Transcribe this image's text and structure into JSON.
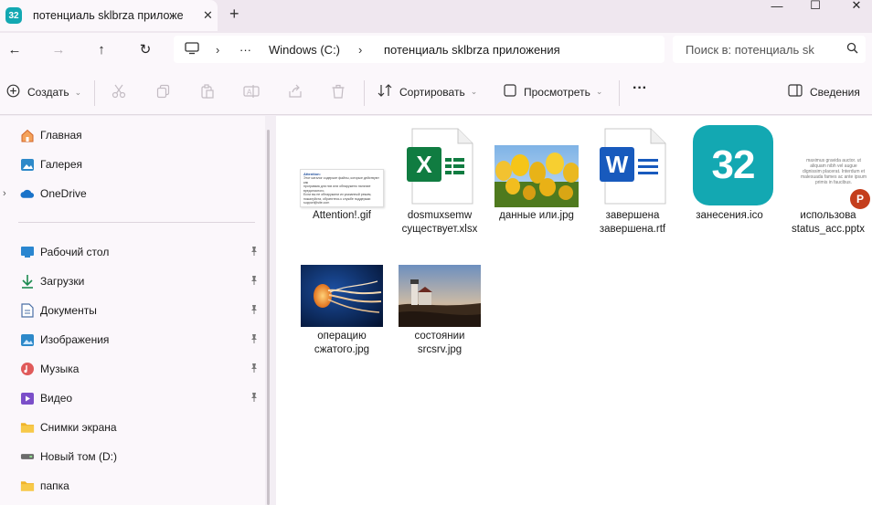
{
  "window": {
    "tab_title": "потенциаль sklbrza приложе",
    "app_badge": "32",
    "close_glyph": "✕",
    "new_tab_glyph": "+",
    "minimize_glyph": "—",
    "maximize_glyph": "☐",
    "window_close_glyph": "✕"
  },
  "nav": {
    "back_glyph": "←",
    "forward_glyph": "→",
    "up_glyph": "↑",
    "refresh_glyph": "↻",
    "more_glyph": "···",
    "separator_glyph": "›",
    "breadcrumb": [
      "Windows (C:)",
      "потенциаль sklbrza приложения"
    ],
    "search_placeholder": "Поиск в:  потенциаль sk",
    "search_icon": "⌕"
  },
  "toolbar": {
    "create_label": "Создать",
    "sort_label": "Сортировать",
    "view_label": "Просмотреть",
    "more_label": "···",
    "details_label": "Сведения",
    "icons": [
      "cut-icon",
      "copy-icon",
      "paste-icon",
      "rename-icon",
      "share-icon",
      "delete-icon"
    ]
  },
  "sidebar": {
    "top_items": [
      {
        "label": "Главная",
        "icon": "home-icon",
        "glyph": "⌂",
        "color": "#e36f2c"
      },
      {
        "label": "Галерея",
        "icon": "gallery-icon",
        "glyph": "▣",
        "color": "#1e7bc4"
      },
      {
        "label": "OneDrive",
        "icon": "onedrive-icon",
        "glyph": "☁",
        "color": "#1a73c9"
      }
    ],
    "pinned_items": [
      {
        "label": "Рабочий стол",
        "icon": "desktop-icon",
        "glyph": "▬",
        "color": "#2a86d0"
      },
      {
        "label": "Загрузки",
        "icon": "downloads-icon",
        "glyph": "↓",
        "color": "#1b8a4f"
      },
      {
        "label": "Документы",
        "icon": "documents-icon",
        "glyph": "▤",
        "color": "#4b6fa5"
      },
      {
        "label": "Изображения",
        "icon": "pictures-icon",
        "glyph": "▲",
        "color": "#2d89c9"
      },
      {
        "label": "Музыка",
        "icon": "music-icon",
        "glyph": "♪",
        "color": "#d9534f"
      },
      {
        "label": "Видео",
        "icon": "video-icon",
        "glyph": "▶",
        "color": "#7b4fc9"
      }
    ],
    "other_items": [
      {
        "label": "Снимки экрана",
        "icon": "folder-icon",
        "glyph": "▬",
        "color": "#f0b429"
      },
      {
        "label": "Новый том (D:)",
        "icon": "drive-icon",
        "glyph": "▭",
        "color": "#555555"
      },
      {
        "label": "папка",
        "icon": "folder-icon",
        "glyph": "▬",
        "color": "#f0b429"
      }
    ],
    "pin_glyph": "📌",
    "expand_glyph": "›"
  },
  "files": [
    {
      "name": [
        "Attention!.gif"
      ],
      "type": "gif-document"
    },
    {
      "name": [
        "dosmuxsemw",
        "существует.xlsx"
      ],
      "type": "excel",
      "letter": "X"
    },
    {
      "name": [
        "данные или.jpg"
      ],
      "type": "photo-tulips"
    },
    {
      "name": [
        "завершена",
        "завершена.rtf"
      ],
      "type": "word",
      "letter": "W"
    },
    {
      "name": [
        "занесения.ico"
      ],
      "type": "ico",
      "badge": "32"
    },
    {
      "name": [
        "использова",
        "status_acc.pptx"
      ],
      "type": "powerpoint",
      "letter": "P",
      "preview_text": "maximus gravida auctor. ut aliquam nibh vel augue dignissim placerat. Interdum et malesuada fames ac ante ipsum primis in faucibus."
    },
    {
      "name": [
        "операцию",
        "сжатого.jpg"
      ],
      "type": "photo-jellyfish"
    },
    {
      "name": [
        "состоянии",
        "srcsrv.jpg"
      ],
      "type": "photo-lighthouse"
    }
  ],
  "gif_preview": {
    "heading": "Attention:",
    "lines": [
      "Этот каталог содержит файлы, которые действуют как",
      "программа для них или обнаружено наличие",
      "вредоносного.",
      "Если вы не обнаружили их указанный режим,",
      "пожалуйста, обратитесь к службе поддержки",
      "support@site.com"
    ]
  },
  "colors": {
    "accent": "#13a8b2",
    "excel": "#107c41",
    "word": "#185abd",
    "powerpoint": "#c43e1c"
  }
}
